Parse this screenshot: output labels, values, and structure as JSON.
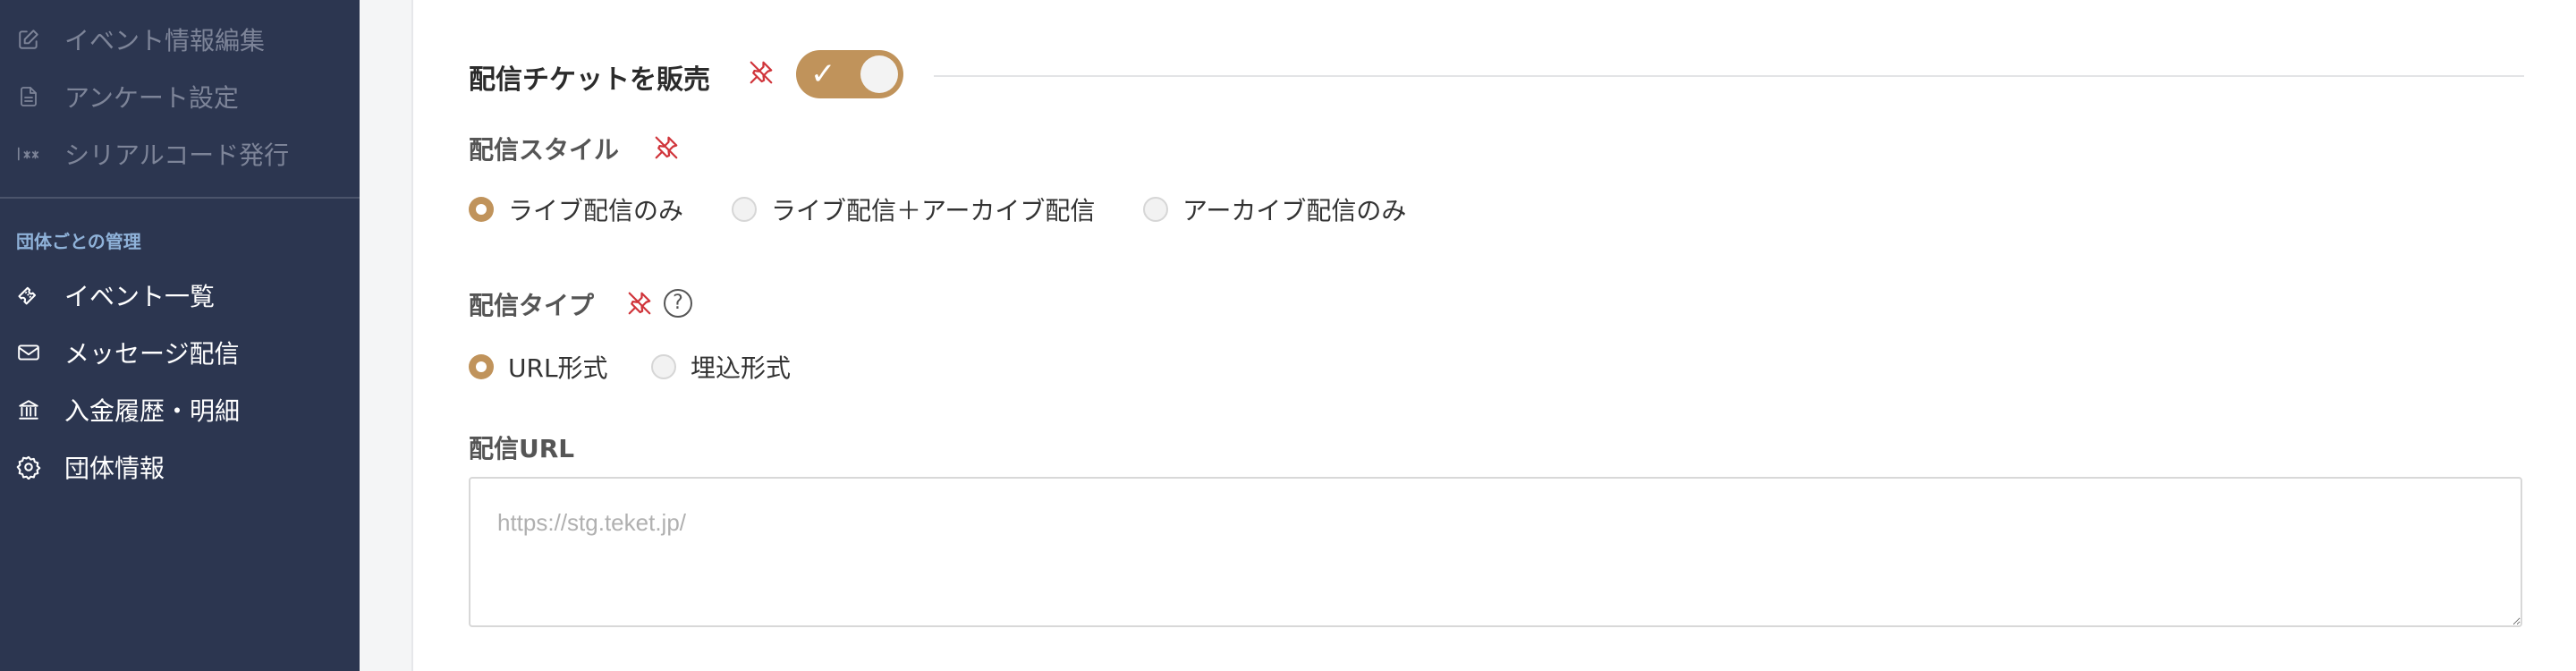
{
  "sidebar": {
    "items_top": [
      {
        "label": "イベント情報編集",
        "icon": "edit-icon"
      },
      {
        "label": "アンケート設定",
        "icon": "document-icon"
      },
      {
        "label": "シリアルコード発行",
        "icon": "serial-code-icon"
      }
    ],
    "section_title": "団体ごとの管理",
    "items_org": [
      {
        "label": "イベント一覧",
        "icon": "ticket-icon"
      },
      {
        "label": "メッセージ配信",
        "icon": "mail-icon"
      },
      {
        "label": "入金履歴・明細",
        "icon": "bank-icon"
      },
      {
        "label": "団体情報",
        "icon": "gear-icon"
      }
    ]
  },
  "form": {
    "section_title": "配信チケットを販売",
    "sell_toggle_on": true,
    "style_label": "配信スタイル",
    "style_options": [
      "ライブ配信のみ",
      "ライブ配信＋アーカイブ配信",
      "アーカイブ配信のみ"
    ],
    "style_selected": 0,
    "type_label": "配信タイプ",
    "type_help": "?",
    "type_options": [
      "URL形式",
      "埋込形式"
    ],
    "type_selected": 0,
    "url_label": "配信URL",
    "url_value": "",
    "url_placeholder": "https://stg.teket.jp/"
  },
  "colors": {
    "sidebar_bg": "#2c3650",
    "accent": "#c0935b",
    "pin_red": "#d0343a"
  }
}
